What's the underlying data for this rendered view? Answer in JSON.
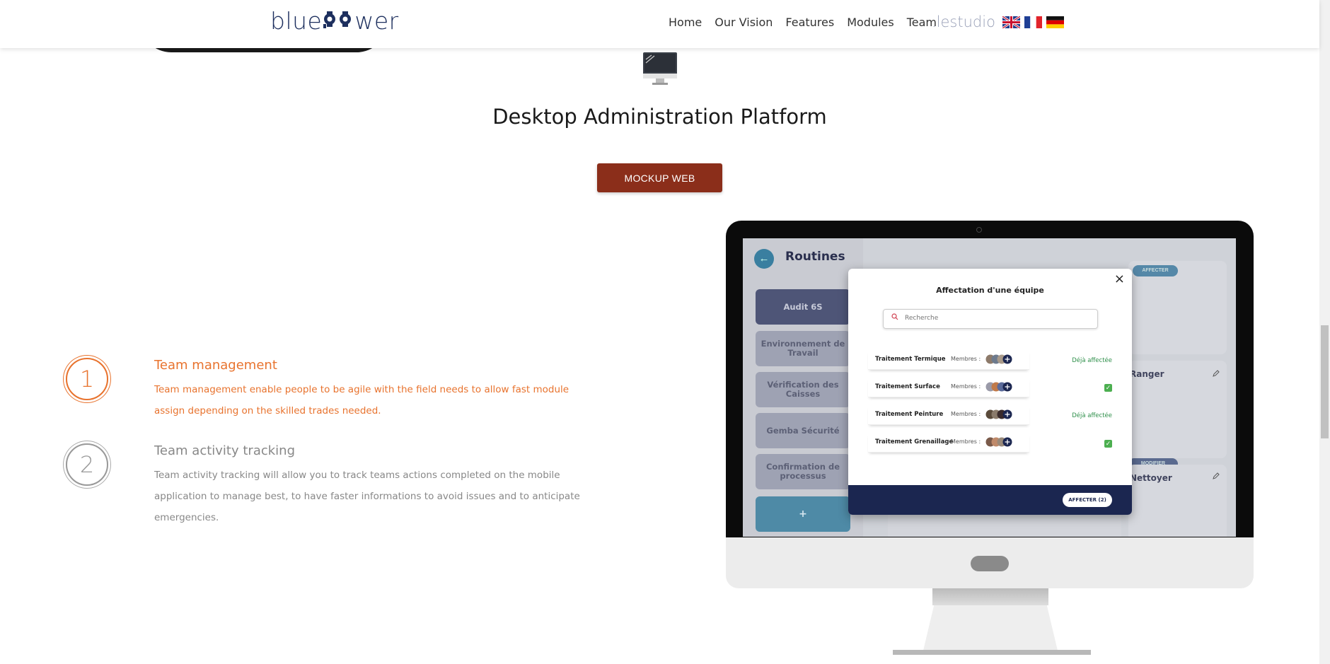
{
  "header": {
    "logo": "blue power",
    "logo_left": "blue",
    "logo_right": "wer",
    "nav": [
      "Home",
      "Our Vision",
      "Features",
      "Modules",
      "Team"
    ],
    "lestudio": ".lestudio",
    "flags": [
      "uk-flag",
      "fr-flag",
      "de-flag"
    ]
  },
  "section": {
    "title": "Desktop Administration Platform",
    "button": "MOCKUP WEB"
  },
  "features": [
    {
      "number": "1",
      "title": "Team management",
      "description": "Team management enable people to be agile with the field needs to allow fast module assign depending on the skilled trades needed.",
      "color": "#e8732e"
    },
    {
      "number": "2",
      "title": "Team activity tracking",
      "description": "Team activity tracking will allow you to track teams actions completed on the mobile application to manage best, to have faster informations to avoid issues and to anticipate emergencies.",
      "color": "#888888"
    }
  ],
  "mockup": {
    "page_title": "Routines",
    "sidebar": [
      "Audit 6S",
      "Environnement de Travail",
      "Vérification des Caisses",
      "Gemba Sécurité",
      "Confirmation de processus",
      "+"
    ],
    "cards": {
      "affecter": "AFFECTER",
      "ranger": "Ranger",
      "modifier": "MODIFIER",
      "nettoyer": "Nettoyer"
    },
    "modal": {
      "title": "Affectation d'une équipe",
      "search_placeholder": "Recherche",
      "members_label": "Membres :",
      "rows": [
        {
          "name": "Traitement Termique",
          "status": "Déjà affectée"
        },
        {
          "name": "Traitement Surface",
          "status": ""
        },
        {
          "name": "Traitement Peinture",
          "status": "Déjà affectée"
        },
        {
          "name": "Traitement Grenaillage",
          "status": ""
        }
      ],
      "assign_button": "AFFECTER (2)",
      "close": "×"
    }
  },
  "colors": {
    "accent": "#e8732e",
    "button": "#8b2e1a",
    "navy": "#1b2650"
  }
}
